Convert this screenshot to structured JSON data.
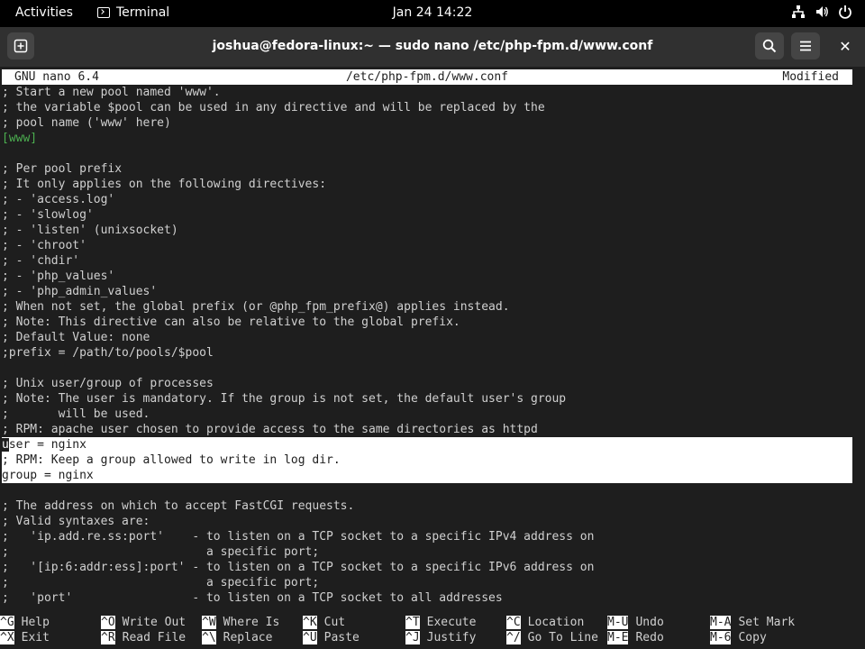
{
  "topbar": {
    "activities": "Activities",
    "app_name": "Terminal",
    "clock": "Jan 24  14:22"
  },
  "window": {
    "title": "joshua@fedora-linux:~ — sudo nano /etc/php-fpm.d/www.conf"
  },
  "nano": {
    "version": "GNU nano 6.4",
    "filename": "/etc/php-fpm.d/www.conf",
    "status": "Modified",
    "lines": [
      "; Start a new pool named 'www'.",
      "; the variable $pool can be used in any directive and will be replaced by the",
      "; pool name ('www' here)",
      "[www]",
      "",
      "; Per pool prefix",
      "; It only applies on the following directives:",
      "; - 'access.log'",
      "; - 'slowlog'",
      "; - 'listen' (unixsocket)",
      "; - 'chroot'",
      "; - 'chdir'",
      "; - 'php_values'",
      "; - 'php_admin_values'",
      "; When not set, the global prefix (or @php_fpm_prefix@) applies instead.",
      "; Note: This directive can also be relative to the global prefix.",
      "; Default Value: none",
      ";prefix = /path/to/pools/$pool",
      "",
      "; Unix user/group of processes",
      "; Note: The user is mandatory. If the group is not set, the default user's group",
      ";       will be used.",
      "; RPM: apache user chosen to provide access to the same directories as httpd",
      "user = nginx",
      "; RPM: Keep a group allowed to write in log dir.",
      "group = nginx",
      "",
      "; The address on which to accept FastCGI requests.",
      "; Valid syntaxes are:",
      ";   'ip.add.re.ss:port'    - to listen on a TCP socket to a specific IPv4 address on",
      ";                            a specific port;",
      ";   '[ip:6:addr:ess]:port' - to listen on a TCP socket to a specific IPv6 address on",
      ";                            a specific port;",
      ";   'port'                 - to listen on a TCP socket to all addresses"
    ],
    "shortcuts": [
      {
        "key": "^G",
        "label": "Help"
      },
      {
        "key": "^X",
        "label": "Exit"
      },
      {
        "key": "^O",
        "label": "Write Out"
      },
      {
        "key": "^R",
        "label": "Read File"
      },
      {
        "key": "^W",
        "label": "Where Is"
      },
      {
        "key": "^\\",
        "label": "Replace"
      },
      {
        "key": "^K",
        "label": "Cut"
      },
      {
        "key": "^U",
        "label": "Paste"
      },
      {
        "key": "^T",
        "label": "Execute"
      },
      {
        "key": "^J",
        "label": "Justify"
      },
      {
        "key": "^C",
        "label": "Location"
      },
      {
        "key": "^/",
        "label": "Go To Line"
      },
      {
        "key": "M-U",
        "label": "Undo"
      },
      {
        "key": "M-E",
        "label": "Redo"
      },
      {
        "key": "M-A",
        "label": "Set Mark"
      },
      {
        "key": "M-6",
        "label": "Copy"
      }
    ]
  },
  "colors": {
    "terminal_bg": "#1e1e1e",
    "header_bg": "#303030",
    "section_header": "#4caf50",
    "highlight_bg": "#ffffff"
  }
}
